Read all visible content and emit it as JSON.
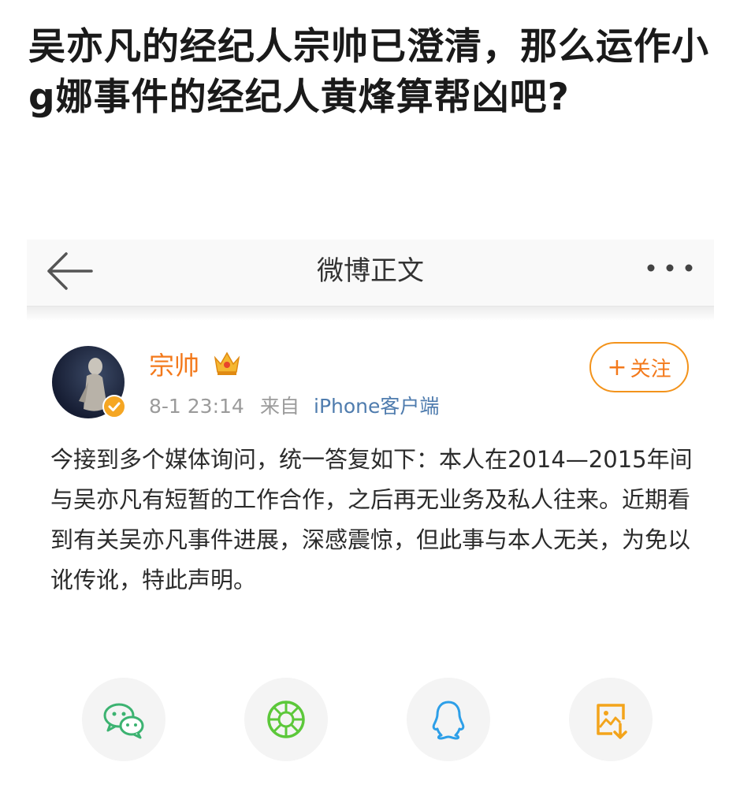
{
  "question": {
    "title": "吴亦凡的经纪人宗帅已澄清，那么运作小g娜事件的经纪人黄烽算帮凶吧?"
  },
  "navbar": {
    "title": "微博正文",
    "back_icon": "back-arrow-icon",
    "more_icon": "more-dots-icon"
  },
  "post": {
    "author": "宗帅",
    "author_badge_icon": "crown-icon",
    "verified_icon": "verified-icon",
    "time": "8-1 23:14",
    "from_label": "来自",
    "source": "iPhone客户端",
    "follow_label": "关注",
    "follow_plus": "+",
    "body": "今接到多个媒体询问，统一答复如下：本人在2014—2015年间与吴亦凡有短暂的工作合作，之后再无业务及私人往来。近期看到有关吴亦凡事件进展，深感震惊，但此事与本人无关，为免以讹传讹，特此声明。"
  },
  "share": {
    "items": [
      {
        "icon": "wechat-icon",
        "color": "#3cb371"
      },
      {
        "icon": "moments-icon",
        "color": "#5cc83a"
      },
      {
        "icon": "qq-icon",
        "color": "#2d9fe8"
      },
      {
        "icon": "save-image-icon",
        "color": "#f3a41b"
      }
    ]
  },
  "colors": {
    "accent": "#f3791b",
    "link": "#4f7cae",
    "muted": "#9b9b9b"
  }
}
